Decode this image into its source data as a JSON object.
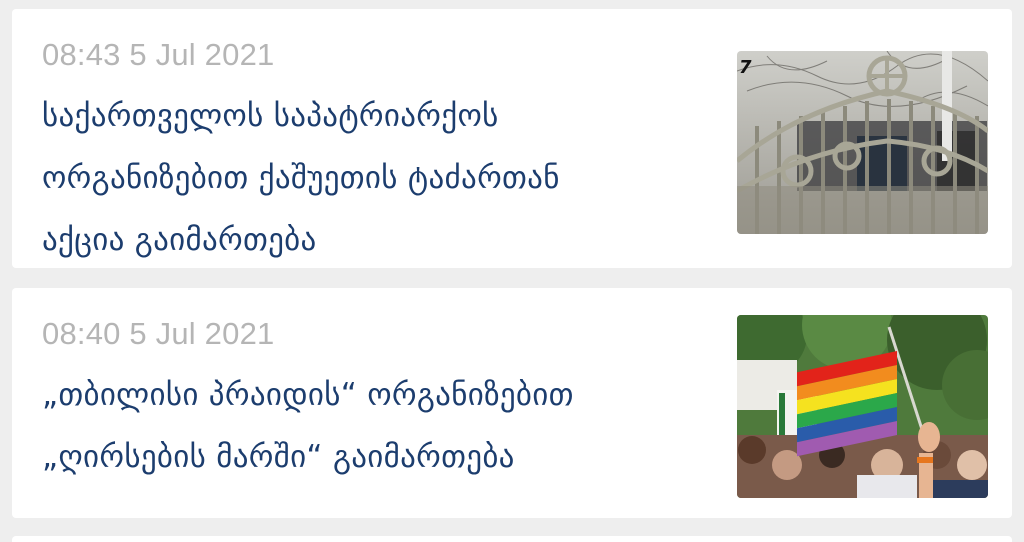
{
  "feed": {
    "articles": [
      {
        "timestamp": "08:43 5 Jul 2021",
        "headline_lines": [
          "საქართველოს საპატრიარქოს",
          "ორგანიზებით ქაშუეთის ტაძართან",
          "აქცია გაიმართება"
        ],
        "image": {
          "icon": "church-gate-photo",
          "logo_text": "7"
        }
      },
      {
        "timestamp": "08:40 5 Jul 2021",
        "headline_lines": [
          "„თბილისი პრაიდის“ ორგანიზებით",
          "„ღირსების მარში“ გაიმართება"
        ],
        "image": {
          "icon": "rainbow-flag-photo"
        }
      }
    ]
  },
  "colors": {
    "background": "#eeeeee",
    "card": "#ffffff",
    "timestamp": "#b5b5b5",
    "headline": "#1c3d6e"
  }
}
